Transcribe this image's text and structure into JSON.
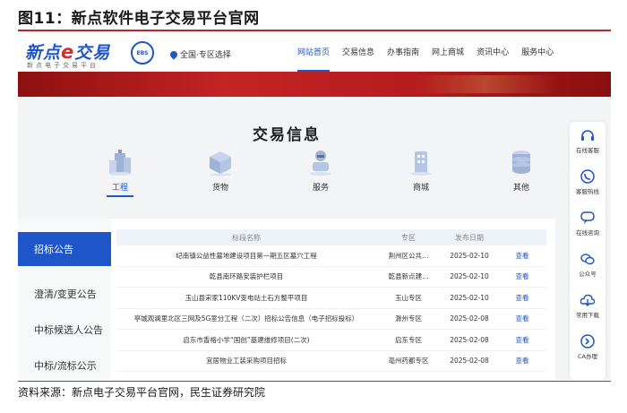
{
  "figure": {
    "title": "图11：新点软件电子交易平台官网",
    "source": "资料来源：新点电子交易平台官网，民生证券研究院"
  },
  "header": {
    "logo_text_main": "新点",
    "logo_text_e": "e",
    "logo_text_tail": "交易",
    "logo_subtitle": "新点电子交易平台",
    "ebs_badge": "EBS",
    "region_label": "全国·专区选择",
    "nav": [
      {
        "label": "网站首页",
        "active": true
      },
      {
        "label": "交易信息",
        "active": false
      },
      {
        "label": "办事指南",
        "active": false
      },
      {
        "label": "网上商城",
        "active": false
      },
      {
        "label": "资讯中心",
        "active": false
      },
      {
        "label": "服务中心",
        "active": false
      }
    ]
  },
  "main": {
    "section_title": "交易信息",
    "categories": [
      {
        "label": "工程",
        "icon": "building-icon",
        "active": true
      },
      {
        "label": "货物",
        "icon": "box-icon",
        "active": false
      },
      {
        "label": "服务",
        "icon": "service-icon",
        "active": false
      },
      {
        "label": "商城",
        "icon": "shop-icon",
        "active": false
      },
      {
        "label": "其他",
        "icon": "database-icon",
        "active": false
      }
    ],
    "side_menu": [
      {
        "label": "招标公告",
        "active": true
      },
      {
        "label": "澄清/变更公告",
        "active": false
      },
      {
        "label": "中标候选人公告",
        "active": false
      },
      {
        "label": "中标/流标公示",
        "active": false
      }
    ],
    "table": {
      "headers": [
        "标段名称",
        "专区",
        "发布日期",
        ""
      ],
      "rows": [
        {
          "name": "纪南镇公益性墓地建设项目第一期五区墓穴工程",
          "area": "荆州区公共...",
          "date": "2025-02-10",
          "action": "查看"
        },
        {
          "name": "乾县南环路安装护栏项目",
          "area": "乾县新点建...",
          "date": "2025-02-10",
          "action": "查看"
        },
        {
          "name": "玉山县宋家110KV变电站土石方整平项目",
          "area": "玉山专区",
          "date": "2025-02-10",
          "action": "查看"
        },
        {
          "name": "亭城观澜里北区三网及5G室分工程（二次）招标公告信息（电子招标投标）",
          "area": "滁州专区",
          "date": "2025-02-08",
          "action": "查看"
        },
        {
          "name": "启东市香格小学“国创”基建维修项目(二次)",
          "area": "启东专区",
          "date": "2025-02-08",
          "action": "查看"
        },
        {
          "name": "宜居物业工装采购项目招标",
          "area": "亳州药都专区",
          "date": "2025-02-08",
          "action": "查看"
        }
      ]
    }
  },
  "float_bar": [
    {
      "label": "在线客服",
      "icon": "headset-icon"
    },
    {
      "label": "客服热线",
      "icon": "phone-icon"
    },
    {
      "label": "在线咨询",
      "icon": "chat-icon"
    },
    {
      "label": "公众号",
      "icon": "wechat-icon"
    },
    {
      "label": "常用下载",
      "icon": "cloud-download-icon"
    },
    {
      "label": "CA办理",
      "icon": "ca-icon"
    }
  ],
  "colors": {
    "accent": "#1e55c8",
    "banner": "#b71c1c",
    "title_rule": "#b52a2a"
  }
}
